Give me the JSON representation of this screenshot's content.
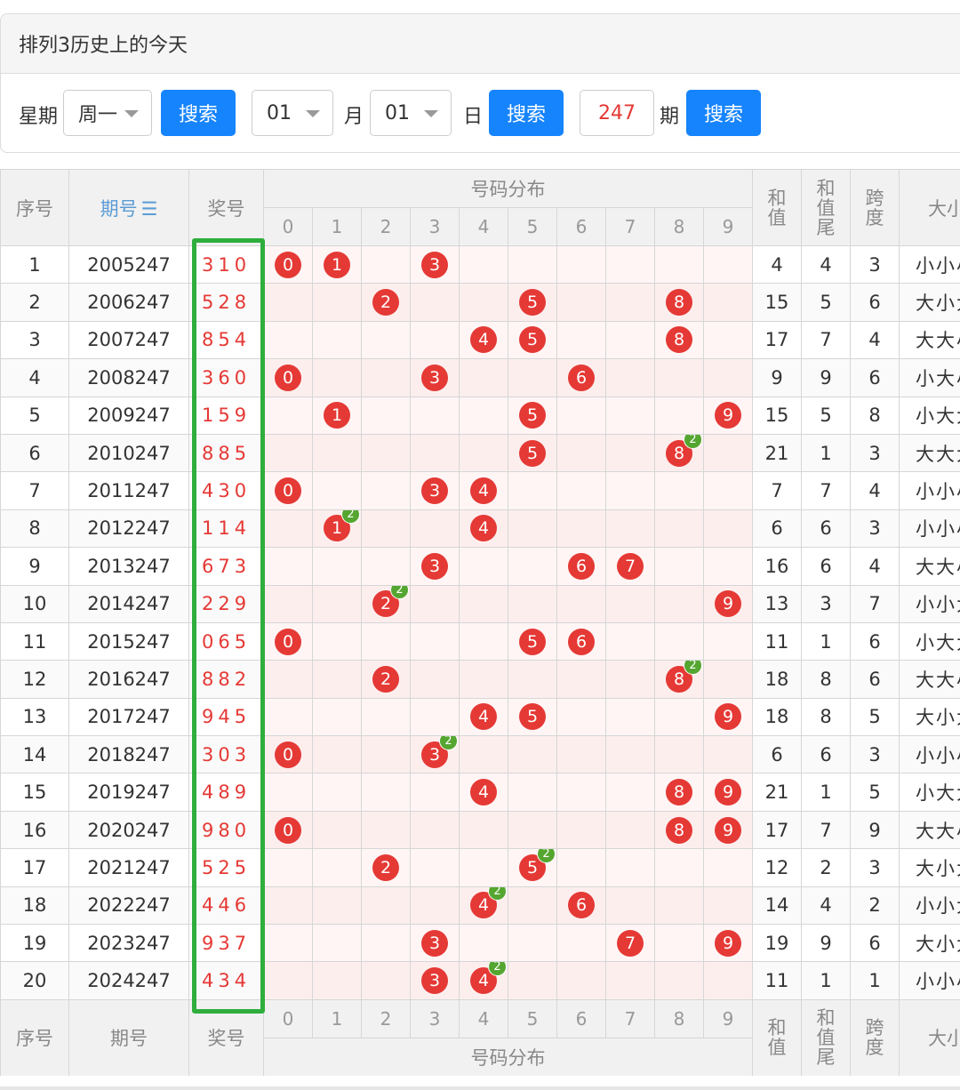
{
  "title": "排列3历史上的今天",
  "search": {
    "weekday_label": "星期",
    "weekday_value": "周一",
    "month_value": "01",
    "month_label": "月",
    "day_value": "01",
    "day_label": "日",
    "period_value": "247",
    "period_label": "期",
    "button_label": "搜索"
  },
  "table": {
    "headers": {
      "index": "序号",
      "period": "期号",
      "period_sort_icon": "sort-icon",
      "number": "奖号",
      "distribution": "号码分布",
      "sum": "和\n值",
      "sum_tail": "和\n值\n尾",
      "span": "跨\n度",
      "size": "大小"
    },
    "digits": [
      "0",
      "1",
      "2",
      "3",
      "4",
      "5",
      "6",
      "7",
      "8",
      "9"
    ],
    "rows": [
      {
        "idx": "1",
        "period": "2005247",
        "num": "310",
        "sum": "4",
        "tail": "4",
        "span": "3",
        "size": "小小小",
        "dup": ""
      },
      {
        "idx": "2",
        "period": "2006247",
        "num": "528",
        "sum": "15",
        "tail": "5",
        "span": "6",
        "size": "大小大",
        "dup": ""
      },
      {
        "idx": "3",
        "period": "2007247",
        "num": "854",
        "sum": "17",
        "tail": "7",
        "span": "4",
        "size": "大大小",
        "dup": ""
      },
      {
        "idx": "4",
        "period": "2008247",
        "num": "360",
        "sum": "9",
        "tail": "9",
        "span": "6",
        "size": "小大小",
        "dup": ""
      },
      {
        "idx": "5",
        "period": "2009247",
        "num": "159",
        "sum": "15",
        "tail": "5",
        "span": "8",
        "size": "小大大",
        "dup": ""
      },
      {
        "idx": "6",
        "period": "2010247",
        "num": "885",
        "sum": "21",
        "tail": "1",
        "span": "3",
        "size": "大大大",
        "dup": "8"
      },
      {
        "idx": "7",
        "period": "2011247",
        "num": "430",
        "sum": "7",
        "tail": "7",
        "span": "4",
        "size": "小小小",
        "dup": ""
      },
      {
        "idx": "8",
        "period": "2012247",
        "num": "114",
        "sum": "6",
        "tail": "6",
        "span": "3",
        "size": "小小小",
        "dup": "1"
      },
      {
        "idx": "9",
        "period": "2013247",
        "num": "673",
        "sum": "16",
        "tail": "6",
        "span": "4",
        "size": "大大小",
        "dup": ""
      },
      {
        "idx": "10",
        "period": "2014247",
        "num": "229",
        "sum": "13",
        "tail": "3",
        "span": "7",
        "size": "小小大",
        "dup": "2"
      },
      {
        "idx": "11",
        "period": "2015247",
        "num": "065",
        "sum": "11",
        "tail": "1",
        "span": "6",
        "size": "小大大",
        "dup": ""
      },
      {
        "idx": "12",
        "period": "2016247",
        "num": "882",
        "sum": "18",
        "tail": "8",
        "span": "6",
        "size": "大大小",
        "dup": "8"
      },
      {
        "idx": "13",
        "period": "2017247",
        "num": "945",
        "sum": "18",
        "tail": "8",
        "span": "5",
        "size": "大小大",
        "dup": ""
      },
      {
        "idx": "14",
        "period": "2018247",
        "num": "303",
        "sum": "6",
        "tail": "6",
        "span": "3",
        "size": "小小小",
        "dup": "3"
      },
      {
        "idx": "15",
        "period": "2019247",
        "num": "489",
        "sum": "21",
        "tail": "1",
        "span": "5",
        "size": "小大大",
        "dup": ""
      },
      {
        "idx": "16",
        "period": "2020247",
        "num": "980",
        "sum": "17",
        "tail": "7",
        "span": "9",
        "size": "大大小",
        "dup": ""
      },
      {
        "idx": "17",
        "period": "2021247",
        "num": "525",
        "sum": "12",
        "tail": "2",
        "span": "3",
        "size": "大小大",
        "dup": "5"
      },
      {
        "idx": "18",
        "period": "2022247",
        "num": "446",
        "sum": "14",
        "tail": "4",
        "span": "2",
        "size": "小小大",
        "dup": "4"
      },
      {
        "idx": "19",
        "period": "2023247",
        "num": "937",
        "sum": "19",
        "tail": "9",
        "span": "6",
        "size": "大小大",
        "dup": ""
      },
      {
        "idx": "20",
        "period": "2024247",
        "num": "434",
        "sum": "11",
        "tail": "1",
        "span": "1",
        "size": "小小小",
        "dup": "4"
      }
    ],
    "repeat_badge": "2"
  },
  "colors": {
    "accent_blue": "#1684fc",
    "ball_red": "#e53935",
    "badge_green": "#55a630",
    "highlight_green": "#2fae3d"
  }
}
